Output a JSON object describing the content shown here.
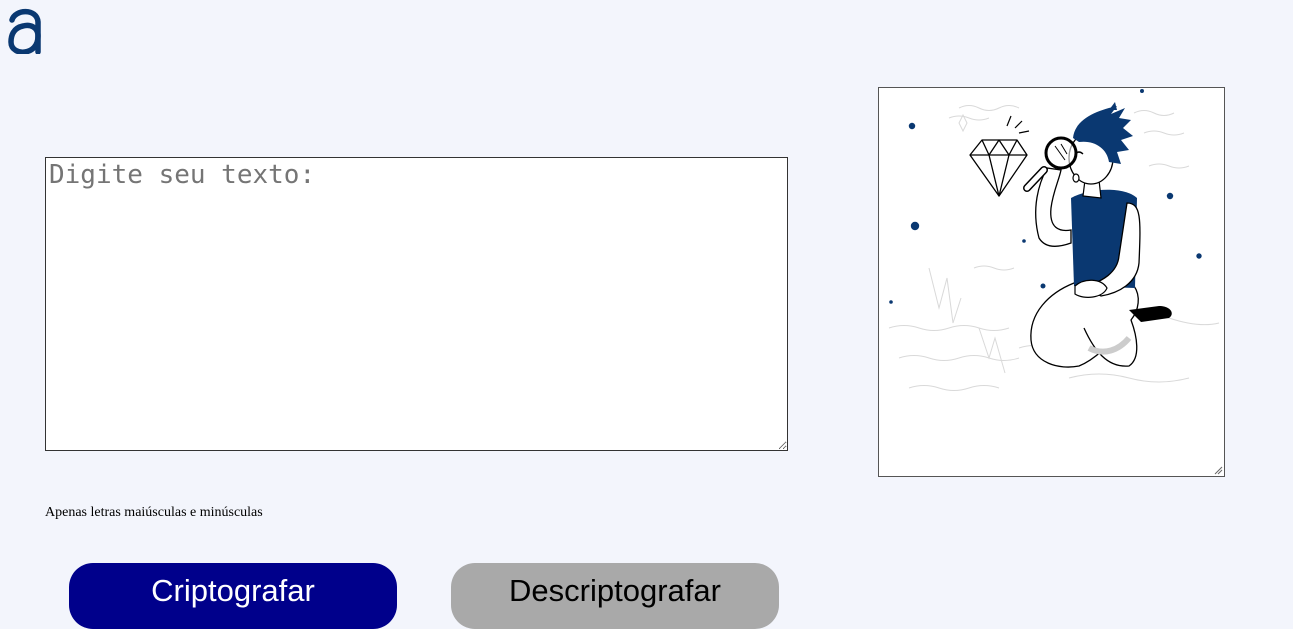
{
  "brand": {
    "logo_icon": "alura-a-logo-icon",
    "color": "#0A3871"
  },
  "input": {
    "placeholder": "Digite seu texto:",
    "value": ""
  },
  "output": {
    "illustration_icon": "person-with-magnifying-glass-diamond-icon",
    "accent_color": "#0A3871"
  },
  "hint": {
    "text": "Apenas letras maiúsculas e minúsculas"
  },
  "buttons": {
    "encrypt_label": "Criptografar",
    "encrypt_color": "#00008B",
    "decrypt_label": "Descriptografar",
    "decrypt_color": "#A9A9A9"
  },
  "page": {
    "background": "#F3F5FC"
  }
}
